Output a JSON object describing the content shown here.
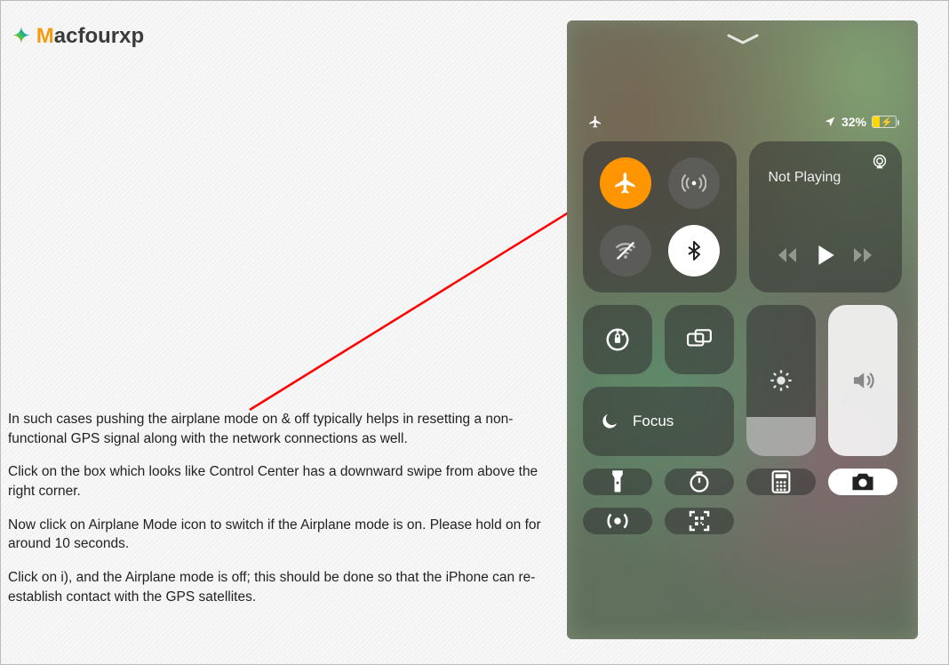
{
  "logo": {
    "brand_m": "M",
    "brand_rest": "acfourxp"
  },
  "instructions": {
    "p1": "In such cases pushing the airplane mode on & off typically helps in resetting a non-functional GPS signal along with the network connections as well.",
    "p2": "Click on the box which looks like Control Center has a downward swipe from above the right corner.",
    "p3": "Now click on Airplane Mode icon to switch if the Airplane mode is on. Please hold on for around 10 seconds.",
    "p4": "Click on i), and the Airplane mode is off; this should be done so that the iPhone can re-establish contact with the GPS satellites."
  },
  "status": {
    "battery_text": "32%"
  },
  "media": {
    "label": "Not Playing"
  },
  "focus": {
    "label": "Focus"
  }
}
